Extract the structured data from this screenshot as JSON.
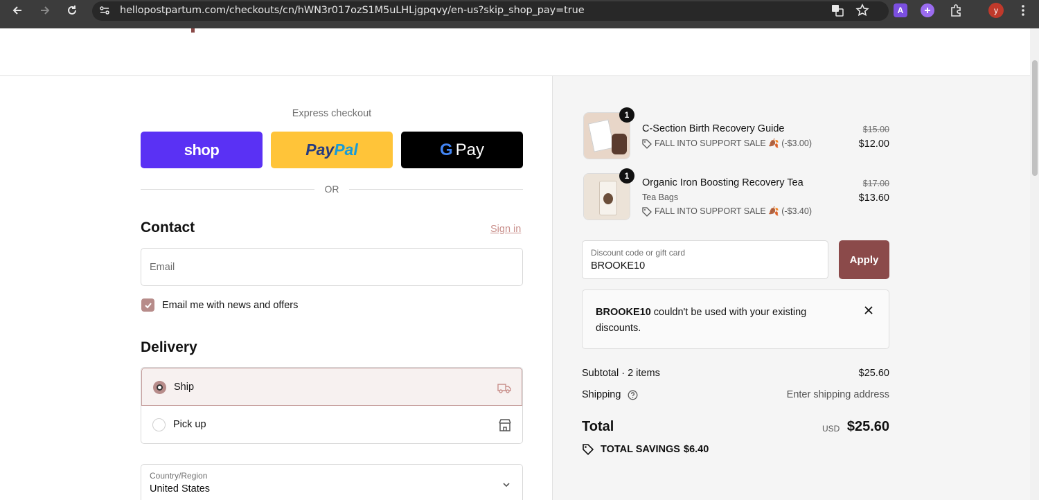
{
  "browser": {
    "url": "hellopostpartum.com/checkouts/cn/hWN3r017ozS1M5uLHLjgpqvy/en-us?skip_shop_pay=true",
    "avatar_letter": "y",
    "ext_letter": "A"
  },
  "express": {
    "label": "Express checkout",
    "shop_label": "shop",
    "paypal_label": "PayPal",
    "gpay_label": "Pay",
    "or_label": "OR"
  },
  "contact": {
    "heading": "Contact",
    "signin": "Sign in",
    "email_placeholder": "Email",
    "newsletter_label": "Email me with news and offers",
    "newsletter_checked": true
  },
  "delivery": {
    "heading": "Delivery",
    "options": [
      {
        "label": "Ship",
        "selected": true,
        "icon": "truck-icon"
      },
      {
        "label": "Pick up",
        "selected": false,
        "icon": "store-icon"
      }
    ],
    "country_label": "Country/Region",
    "country_value": "United States"
  },
  "cart": {
    "items": [
      {
        "quantity": "1",
        "title": "C-Section Birth Recovery Guide",
        "variant": "",
        "discount": "FALL INTO SUPPORT SALE 🍂 (-$3.00)",
        "original_price": "$15.00",
        "price": "$12.00"
      },
      {
        "quantity": "1",
        "title": "Organic Iron Boosting Recovery Tea",
        "variant": "Tea Bags",
        "discount": "FALL INTO SUPPORT SALE 🍂 (-$3.40)",
        "original_price": "$17.00",
        "price": "$13.60"
      }
    ],
    "discount_field": {
      "label": "Discount code or gift card",
      "value": "BROOKE10"
    },
    "apply_label": "Apply",
    "error": {
      "code": "BROOKE10",
      "message": " couldn't be used with your existing discounts."
    },
    "summary": {
      "subtotal_label": "Subtotal · 2 items",
      "subtotal_value": "$25.60",
      "shipping_label": "Shipping",
      "shipping_value": "Enter shipping address",
      "total_label": "Total",
      "currency": "USD",
      "total_value": "$25.60",
      "savings_label": "TOTAL SAVINGS",
      "savings_value": "$6.40"
    }
  },
  "colors": {
    "accent": "#8b4a4a",
    "accent_light": "#b78c8a",
    "shop_purple": "#5a31f4",
    "paypal_yellow": "#ffc439"
  }
}
